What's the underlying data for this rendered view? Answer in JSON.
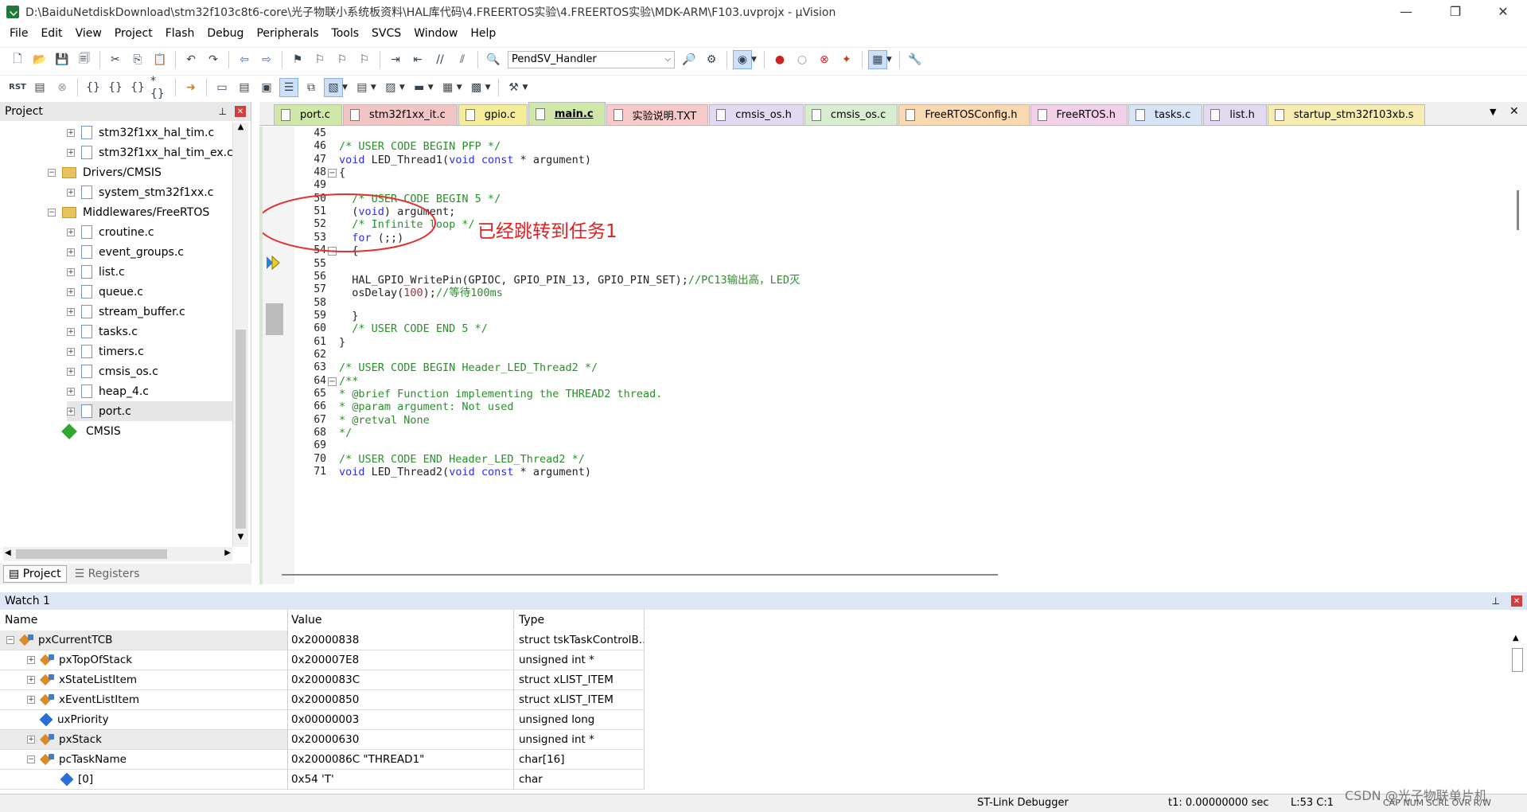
{
  "window": {
    "title": "D:\\BaiduNetdiskDownload\\stm32f103c8t6-core\\光子物联小系统板资料\\HAL库代码\\4.FREERTOS实验\\4.FREERTOS实验\\MDK-ARM\\F103.uvprojx - µVision"
  },
  "menu": [
    "File",
    "Edit",
    "View",
    "Project",
    "Flash",
    "Debug",
    "Peripherals",
    "Tools",
    "SVCS",
    "Window",
    "Help"
  ],
  "toolbar": {
    "function_select": "PendSV_Handler"
  },
  "project_panel": {
    "title": "Project",
    "tree": [
      "stm32f1xx_hal_tim.c",
      "stm32f1xx_hal_tim_ex.c",
      "Drivers/CMSIS",
      "system_stm32f1xx.c",
      "Middlewares/FreeRTOS",
      "croutine.c",
      "event_groups.c",
      "list.c",
      "queue.c",
      "stream_buffer.c",
      "tasks.c",
      "timers.c",
      "cmsis_os.c",
      "heap_4.c",
      "port.c",
      "CMSIS"
    ],
    "bottom_tabs": [
      "Project",
      "Registers"
    ]
  },
  "editor": {
    "tabs": [
      "port.c",
      "stm32f1xx_it.c",
      "gpio.c",
      "main.c",
      "实验说明.TXT",
      "cmsis_os.h",
      "cmsis_os.c",
      "FreeRTOSConfig.h",
      "FreeRTOS.h",
      "tasks.c",
      "list.h",
      "startup_stm32f103xb.s"
    ],
    "tab_colors": [
      "#cfe8a8",
      "#f2c4c4",
      "#f5ec9a",
      "#cfe8a8",
      "#f7c9c9",
      "#e3d9f0",
      "#d8ecd0",
      "#fbd9b0",
      "#f2d0e8",
      "#d6e4f5",
      "#e3d9f0",
      "#f7ecb0"
    ],
    "active_tab": "main.c",
    "lines": [
      {
        "n": "45",
        "text": ""
      },
      {
        "n": "46",
        "text": "/* USER CODE BEGIN PFP */"
      },
      {
        "n": "47",
        "text": "void LED_Thread1(void const * argument)"
      },
      {
        "n": "48",
        "text": "{"
      },
      {
        "n": "49",
        "text": ""
      },
      {
        "n": "50",
        "text": "  /* USER CODE BEGIN 5 */"
      },
      {
        "n": "51",
        "text": "  (void) argument;"
      },
      {
        "n": "52",
        "text": "  /* Infinite loop */"
      },
      {
        "n": "53",
        "text": "  for (;;)"
      },
      {
        "n": "54",
        "text": "  {"
      },
      {
        "n": "55",
        "text": ""
      },
      {
        "n": "56",
        "text": "  HAL_GPIO_WritePin(GPIOC, GPIO_PIN_13, GPIO_PIN_SET);//PC13输出高，LED灭"
      },
      {
        "n": "57",
        "text": "  osDelay(100);//等待100ms"
      },
      {
        "n": "58",
        "text": ""
      },
      {
        "n": "59",
        "text": "  }"
      },
      {
        "n": "60",
        "text": "  /* USER CODE END 5 */"
      },
      {
        "n": "61",
        "text": "}"
      },
      {
        "n": "62",
        "text": ""
      },
      {
        "n": "63",
        "text": "/* USER CODE BEGIN Header_LED_Thread2 */"
      },
      {
        "n": "64",
        "text": "/**"
      },
      {
        "n": "65",
        "text": "* @brief Function implementing the THREAD2 thread."
      },
      {
        "n": "66",
        "text": "* @param argument: Not used"
      },
      {
        "n": "67",
        "text": "* @retval None"
      },
      {
        "n": "68",
        "text": "*/"
      },
      {
        "n": "69",
        "text": ""
      },
      {
        "n": "70",
        "text": "/* USER CODE END Header_LED_Thread2 */"
      },
      {
        "n": "71",
        "text": "void LED_Thread2(void const * argument)"
      }
    ],
    "annotation": "已经跳转到任务1"
  },
  "watch": {
    "title": "Watch 1",
    "columns": [
      "Name",
      "Value",
      "Type"
    ],
    "rows": [
      {
        "name": "pxCurrentTCB",
        "value": "0x20000838",
        "type": "struct tskTaskControlB..."
      },
      {
        "name": "pxTopOfStack",
        "value": "0x200007E8",
        "type": "unsigned int *"
      },
      {
        "name": "xStateListItem",
        "value": "0x2000083C",
        "type": "struct xLIST_ITEM"
      },
      {
        "name": "xEventListItem",
        "value": "0x20000850",
        "type": "struct xLIST_ITEM"
      },
      {
        "name": "uxPriority",
        "value": "0x00000003",
        "type": "unsigned long"
      },
      {
        "name": "pxStack",
        "value": "0x20000630",
        "type": "unsigned int *"
      },
      {
        "name": "pcTaskName",
        "value": "0x2000086C \"THREAD1\"",
        "type": "char[16]"
      },
      {
        "name": "[0]",
        "value": "0x54 'T'",
        "type": "char"
      }
    ]
  },
  "status": {
    "debugger": "ST-Link Debugger",
    "time": "t1: 0.00000000 sec",
    "position": "L:53 C:1",
    "flags": "CAP NUM SCRL OVR R/W",
    "watermark": "CSDN @光子物联单片机"
  }
}
